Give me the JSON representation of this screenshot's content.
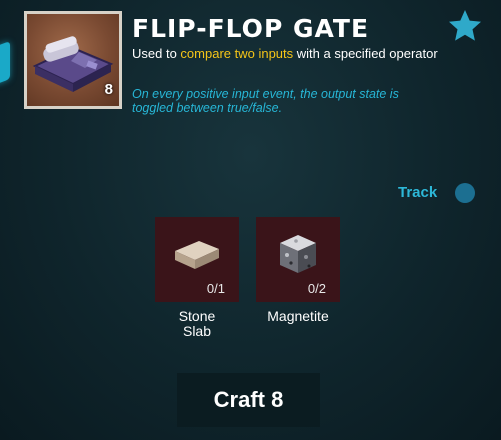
{
  "item": {
    "title": "FLIP-FLOP GATE",
    "quantity": "8",
    "icon": "flip-flop-gate-icon",
    "subtitle": {
      "prefix": "Used to ",
      "highlight": "compare two inputs",
      "suffix": " with a specified operator"
    },
    "description_lines": [
      "On every positive input event, the output state is",
      "toggled between true/false."
    ]
  },
  "favorite": {
    "icon": "star-icon"
  },
  "track": {
    "label": "Track",
    "enabled": false
  },
  "ingredients": [
    {
      "name_lines": [
        "Stone",
        "Slab"
      ],
      "count": "0/1",
      "icon": "stone-slab-icon"
    },
    {
      "name_lines": [
        "Magnetite"
      ],
      "count": "0/2",
      "icon": "magnetite-icon"
    }
  ],
  "craft_button": {
    "label": "Craft 8"
  },
  "colors": {
    "accent_cyan": "#27b6d6",
    "highlight_yellow": "#f5c518",
    "ingredient_missing_bg": "#3a1419",
    "panel_bg": "#13303a"
  }
}
